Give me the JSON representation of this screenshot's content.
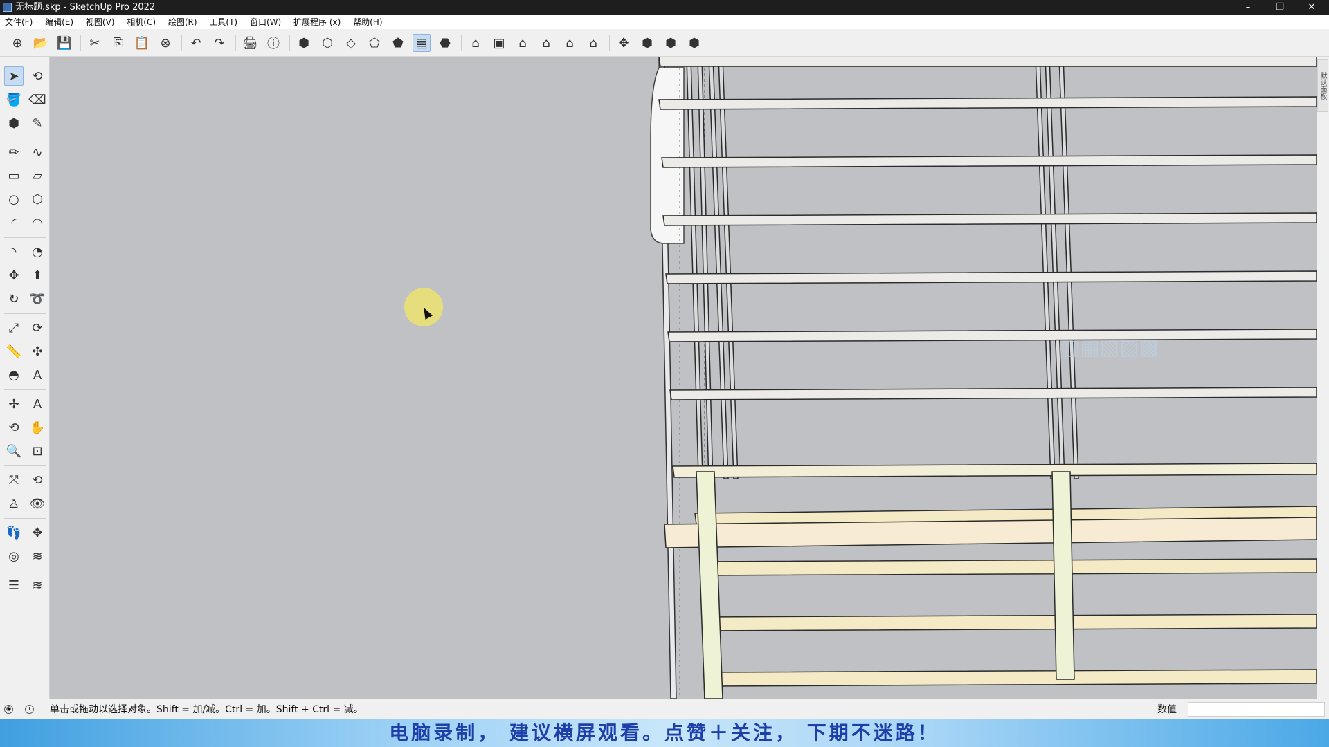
{
  "window": {
    "title": "无标题.skp - SketchUp Pro 2022",
    "controls": {
      "minimize": "–",
      "restore": "❐",
      "close": "✕"
    }
  },
  "menu": [
    "文件(F)",
    "编辑(E)",
    "视图(V)",
    "相机(C)",
    "绘图(R)",
    "工具(T)",
    "窗口(W)",
    "扩展程序 (x)",
    "帮助(H)"
  ],
  "toolbar": {
    "items": [
      {
        "name": "new-icon",
        "glyph": "⊕"
      },
      {
        "name": "open-icon",
        "glyph": "📂"
      },
      {
        "name": "save-icon",
        "glyph": "💾"
      },
      {
        "name": "cut-icon",
        "glyph": "✂"
      },
      {
        "name": "copy-icon",
        "glyph": "⎘"
      },
      {
        "name": "paste-icon",
        "glyph": "📋"
      },
      {
        "name": "erase-icon",
        "glyph": "⊗"
      },
      {
        "name": "undo-icon",
        "glyph": "↶"
      },
      {
        "name": "redo-icon",
        "glyph": "↷"
      },
      {
        "name": "print-icon",
        "glyph": "🖨"
      },
      {
        "name": "model-info-icon",
        "glyph": "ⓘ"
      },
      {
        "name": "xray-icon",
        "glyph": "⬢"
      },
      {
        "name": "back-edges-icon",
        "glyph": "⬡"
      },
      {
        "name": "wireframe-icon",
        "glyph": "◇"
      },
      {
        "name": "hidden-line-icon",
        "glyph": "⬠"
      },
      {
        "name": "shaded-icon",
        "glyph": "⬟"
      },
      {
        "name": "shaded-textures-icon",
        "glyph": "▤"
      },
      {
        "name": "monochrome-icon",
        "glyph": "⬣"
      },
      {
        "name": "iso-view-icon",
        "glyph": "⌂"
      },
      {
        "name": "top-view-icon",
        "glyph": "▣"
      },
      {
        "name": "front-view-icon",
        "glyph": "⌂"
      },
      {
        "name": "right-view-icon",
        "glyph": "⌂"
      },
      {
        "name": "back-view-icon",
        "glyph": "⌂"
      },
      {
        "name": "left-view-icon",
        "glyph": "⌂"
      },
      {
        "name": "section-plane-icon",
        "glyph": "✥"
      },
      {
        "name": "warehouse-icon",
        "glyph": "⬢"
      },
      {
        "name": "extension-warehouse-icon",
        "glyph": "⬢"
      },
      {
        "name": "share-model-icon",
        "glyph": "⬢"
      }
    ]
  },
  "left_tools": [
    {
      "name": "select-icon",
      "glyph": "➤",
      "active": true
    },
    {
      "name": "orbit-lasso-icon",
      "glyph": "⟲"
    },
    {
      "name": "paint-bucket-icon",
      "glyph": "🪣"
    },
    {
      "name": "eraser-icon",
      "glyph": "⌫"
    },
    {
      "name": "component-icon",
      "glyph": "⬢"
    },
    {
      "name": "tag-icon",
      "glyph": "✎"
    },
    {
      "name": "pencil-icon",
      "glyph": "✏"
    },
    {
      "name": "freehand-icon",
      "glyph": "∿"
    },
    {
      "name": "rectangle-icon",
      "glyph": "▭"
    },
    {
      "name": "rotated-rectangle-icon",
      "glyph": "▱"
    },
    {
      "name": "circle-icon",
      "glyph": "○"
    },
    {
      "name": "polygon-icon",
      "glyph": "⬡"
    },
    {
      "name": "arc-icon",
      "glyph": "◜"
    },
    {
      "name": "three-point-arc-icon",
      "glyph": "◠"
    },
    {
      "name": "two-point-arc-icon",
      "glyph": "◝"
    },
    {
      "name": "pie-icon",
      "glyph": "◔"
    },
    {
      "name": "move-icon",
      "glyph": "✥"
    },
    {
      "name": "push-pull-icon",
      "glyph": "⬆"
    },
    {
      "name": "rotate-icon",
      "glyph": "↻"
    },
    {
      "name": "follow-me-icon",
      "glyph": "➰"
    },
    {
      "name": "scale-icon",
      "glyph": "⤢"
    },
    {
      "name": "offset-icon",
      "glyph": "⟳"
    },
    {
      "name": "tape-measure-icon",
      "glyph": "📏"
    },
    {
      "name": "dimension-icon",
      "glyph": "✣"
    },
    {
      "name": "protractor-icon",
      "glyph": "◓"
    },
    {
      "name": "text-icon",
      "glyph": "A"
    },
    {
      "name": "axes-icon",
      "glyph": "✢"
    },
    {
      "name": "3d-text-icon",
      "glyph": "A"
    },
    {
      "name": "orbit-icon",
      "glyph": "⟲"
    },
    {
      "name": "pan-icon",
      "glyph": "✋"
    },
    {
      "name": "zoom-icon",
      "glyph": "🔍"
    },
    {
      "name": "zoom-window-icon",
      "glyph": "⊡"
    },
    {
      "name": "zoom-extents-icon",
      "glyph": "⤧"
    },
    {
      "name": "previous-view-icon",
      "glyph": "⟲"
    },
    {
      "name": "position-camera-icon",
      "glyph": "♙"
    },
    {
      "name": "look-around-icon",
      "glyph": "👁"
    },
    {
      "name": "walk-icon",
      "glyph": "👣"
    },
    {
      "name": "section-plane-tool-icon",
      "glyph": "✥"
    },
    {
      "name": "sandbox-from-contours-icon",
      "glyph": "◎"
    },
    {
      "name": "sandbox-from-scratch-icon",
      "glyph": "≋"
    },
    {
      "name": "smoove-icon",
      "glyph": "☰"
    },
    {
      "name": "stamp-icon",
      "glyph": "≋"
    }
  ],
  "right_panel": {
    "tab": "默认面板"
  },
  "status": {
    "message": "单击或拖动以选择对象。Shift = 加/减。Ctrl = 加。Shift + Ctrl = 减。",
    "value_label": "数值",
    "value": ""
  },
  "banner": {
    "text": "电脑录制， 建议横屏观看。点赞＋关注， 下期不迷路！"
  },
  "colors": {
    "wood": "#efe2bf",
    "wood_edge": "#3b3b3b",
    "viewport_bg": "#c0c1c5",
    "panel_bg": "#d7d7d9"
  }
}
